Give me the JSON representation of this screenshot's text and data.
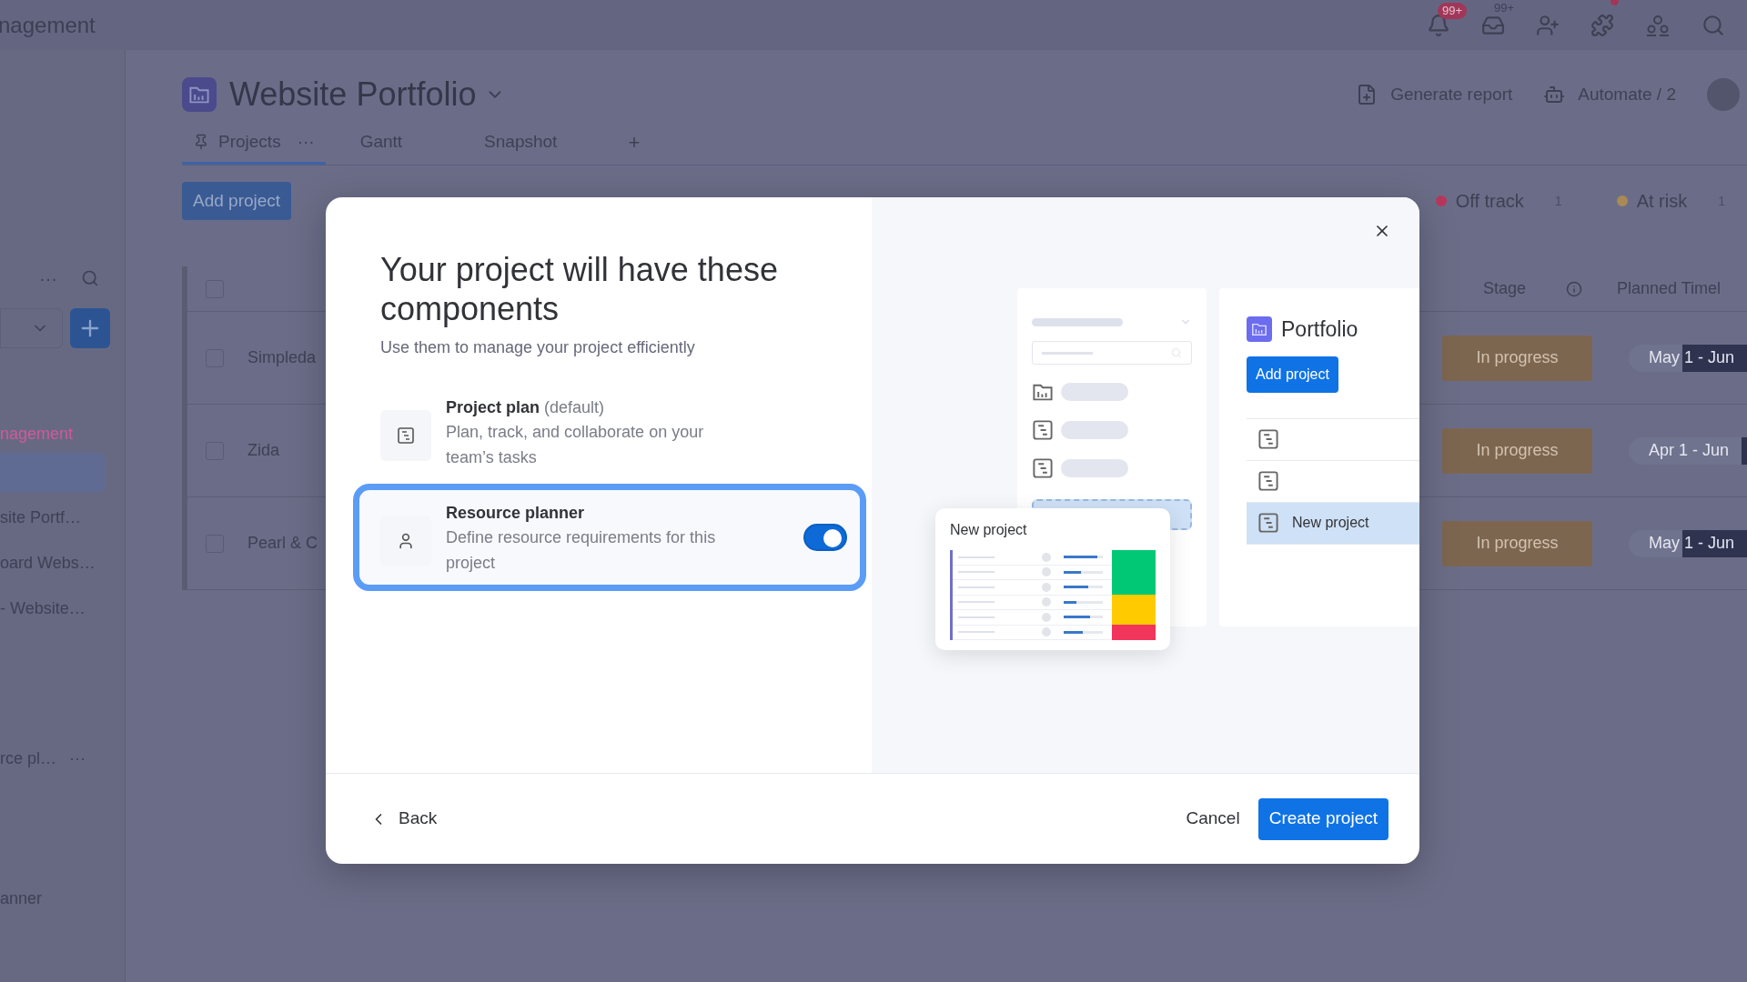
{
  "top_bar": {
    "workspace": "nagement",
    "notifications_badge": "99+",
    "inbox_badge": "99+"
  },
  "sidebar": {
    "heading": "nagement",
    "items": [
      {
        "selected": true
      },
      {
        "label": "site Portf…",
        "selected": false
      },
      {
        "label": "oard Webs…",
        "selected": false
      },
      {
        "label": "- Website…",
        "selected": false
      },
      {
        "label": "rce pl…",
        "selected": false,
        "more": "···"
      },
      {
        "label": "anner",
        "selected": false
      }
    ],
    "more": "···"
  },
  "board": {
    "title": "Website Portfolio",
    "actions": [
      "Generate report",
      "Automate / 2"
    ],
    "tabs": [
      {
        "label": "Projects",
        "selected": true,
        "more": "···"
      },
      {
        "label": "Gantt",
        "selected": false
      },
      {
        "label": "Snapshot",
        "selected": false
      }
    ],
    "add_tab": "+",
    "add_button": "Add project",
    "statuses": [
      {
        "label": "Off track",
        "count": "1",
        "color": "#b8375c"
      },
      {
        "label": "At risk",
        "count": "1",
        "color": "#a88a55"
      }
    ],
    "select_all_checked": false,
    "columns": [
      "Stage",
      "Planned Timel"
    ],
    "rows": [
      {
        "checked": false,
        "name": "Simpleda",
        "stage": "In progress",
        "timeline": "May 1 - Jun",
        "level": 0.55
      },
      {
        "checked": false,
        "name": "Zida",
        "stage": "In progress",
        "timeline": "Apr 1 - Jun",
        "level": 0.05
      },
      {
        "checked": false,
        "name": "Pearl & C",
        "stage": "In progress",
        "timeline": "May 1 - Jun",
        "level": 0.55
      }
    ]
  },
  "modal": {
    "title": "Your project will have these components",
    "subtitle": "Use them to manage your project efficiently",
    "components": [
      {
        "kind": "default",
        "title": "Project plan",
        "note": "(default)",
        "description": "Plan, track, and collaborate on your team’s tasks",
        "selected": false
      },
      {
        "kind": "toggle",
        "title": "Resource planner",
        "description": "Define resource requirements for this project",
        "on": true,
        "selected": true
      }
    ],
    "preview": {
      "portfolio_title": "Portfolio",
      "add_button": "Add project",
      "list_items": [
        {
          "selected": false
        },
        {
          "selected": false
        },
        {
          "label": "New project",
          "selected": true
        }
      ],
      "card_title": "New project",
      "card_rows": [
        {
          "color": "#00c875",
          "level": 0.85
        },
        {
          "color": "#00c875",
          "level": 0.45
        },
        {
          "color": "#00c875",
          "level": 0.62
        },
        {
          "color": "#ffcb00",
          "level": 0.32
        },
        {
          "color": "#ffcb00",
          "level": 0.68
        },
        {
          "color": "#f2355b",
          "level": 0.5
        }
      ]
    },
    "footer": {
      "back": "Back",
      "cancel": "Cancel",
      "create": "Create project"
    }
  }
}
